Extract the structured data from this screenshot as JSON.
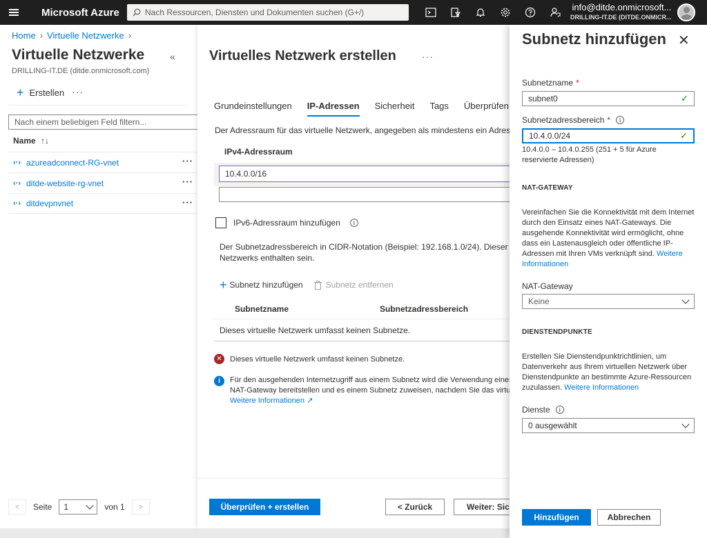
{
  "topbar": {
    "brand": "Microsoft Azure",
    "search_placeholder": "Nach Ressourcen, Diensten und Dokumenten suchen (G+/)",
    "account_email": "info@ditde.onmicrosoft...",
    "account_tenant": "DRILLING-IT.DE (DITDE.ONMICR..."
  },
  "left": {
    "breadcrumb": [
      "Home",
      "Virtuelle Netzwerke"
    ],
    "title": "Virtuelle Netzwerke",
    "subtitle": "DRILLING-IT.DE (ditde.onmicrosoft.com)",
    "create_label": "Erstellen",
    "filter_placeholder": "Nach einem beliebigen Feld filtern...",
    "column_name": "Name",
    "items": [
      {
        "name": "azureadconnect-RG-vnet"
      },
      {
        "name": "ditde-website-rg-vnet"
      },
      {
        "name": "ditdevpnvnet"
      }
    ],
    "pager": {
      "page_label": "Seite",
      "page_value": "1",
      "of_label": "von 1"
    }
  },
  "middle": {
    "title": "Virtuelles Netzwerk erstellen",
    "tabs": [
      "Grundeinstellungen",
      "IP-Adressen",
      "Sicherheit",
      "Tags",
      "Überprüfen +"
    ],
    "active_tab": "IP-Adressen",
    "description": "Der Adressraum für das virtuelle Netzwerk, angegeben als mindestens ein Adressp",
    "ipv4_header": "IPv4-Adressraum",
    "ipv4_value": "10.4.0.0/16",
    "ipv6_checkbox_label": "IPv6-Adressraum hinzufügen",
    "cidr_line1": "Der Subnetzadressbereich in CIDR-Notation (Beispiel: 192.168.1.0/24). Dieser mu",
    "cidr_line2": "Netzwerks enthalten sein.",
    "add_subnet": "Subnetz hinzufügen",
    "remove_subnet": "Subnetz entfernen",
    "col_subnet_name": "Subnetzname",
    "col_subnet_range": "Subnetzadressbereich",
    "empty_row": "Dieses virtuelle Netzwerk umfasst keinen Subnetze.",
    "error_text": "Dieses virtuelle Netzwerk umfasst keinen Subnetze.",
    "info_line1": "Für den ausgehenden Internetzugriff aus einem Subnetz wird die Verwendung eines",
    "info_line2": "NAT-Gateway bereitstellen und es einem Subnetz zuweisen, nachdem Sie das virtuell",
    "info_link": "Weitere Informationen",
    "btn_review": "Überprüfen + erstellen",
    "btn_back": "< Zurück",
    "btn_next": "Weiter: Sich"
  },
  "panel": {
    "title": "Subnetz hinzufügen",
    "subnet_name_label": "Subnetzname",
    "subnet_name_value": "subnet0",
    "range_label": "Subnetzadressbereich",
    "range_value": "10.4.0.0/24",
    "range_hint_line1": "10.4.0.0 – 10.4.0.255 (251 + 5 für Azure",
    "range_hint_line2": "reservierte Adressen)",
    "nat_section": "NAT-GATEWAY",
    "nat_desc_line1": "Vereinfachen Sie die Konnektivität mit dem Internet",
    "nat_desc_line2": "durch den Einsatz eines NAT-Gateways. Die",
    "nat_desc_line3": "ausgehende Konnektivität wird ermöglicht, ohne",
    "nat_desc_line4": "dass ein Lastenausgleich oder öffentliche IP-",
    "nat_desc_line5": "Adressen mit Ihren VMs verknüpft sind.",
    "nat_link_a": "Weitere",
    "nat_link_b": "Informationen",
    "nat_label": "NAT-Gateway",
    "nat_value": "Keine",
    "svc_section": "DIENSTENDPUNKTE",
    "svc_desc_line1": "Erstellen Sie Dienstendpunktrichtlinien, um",
    "svc_desc_line2": "Datenverkehr aus Ihrem virtuellen Netzwerk über",
    "svc_desc_line3": "Dienstendpunkte an bestimmte Azure-Ressourcen",
    "svc_desc_line4": "zuzulassen.",
    "svc_link": "Weitere Informationen",
    "services_label": "Dienste",
    "services_value": "0 ausgewählt",
    "btn_add": "Hinzufügen",
    "btn_cancel": "Abbrechen"
  }
}
